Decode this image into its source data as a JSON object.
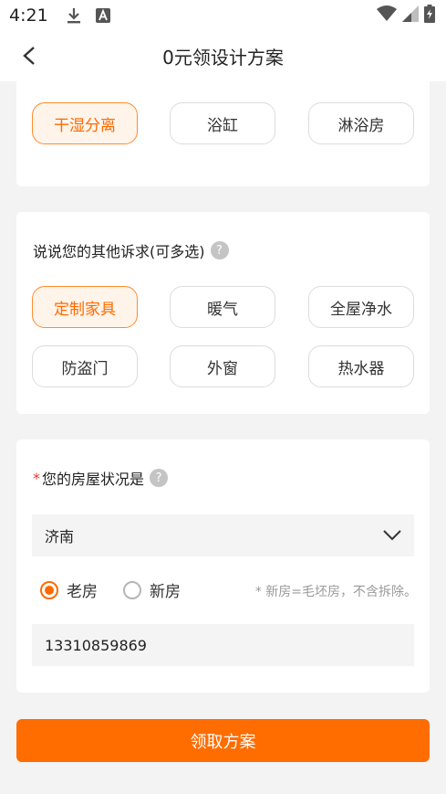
{
  "status_bar": {
    "time": "4:21",
    "icons": [
      "download-icon",
      "font-a-icon",
      "wifi-icon",
      "cell-signal-icon",
      "battery-charging-icon"
    ]
  },
  "header": {
    "title": "0元领设计方案",
    "back_icon": "chevron-left-icon"
  },
  "bathroom_options": [
    {
      "label": "干湿分离",
      "selected": true
    },
    {
      "label": "浴缸",
      "selected": false
    },
    {
      "label": "淋浴房",
      "selected": false
    }
  ],
  "other_requests": {
    "question": "说说您的其他诉求(可多选)",
    "help_mark": "?",
    "options": [
      {
        "label": "定制家具",
        "selected": true
      },
      {
        "label": "暖气",
        "selected": false
      },
      {
        "label": "全屋净水",
        "selected": false
      },
      {
        "label": "防盗门",
        "selected": false
      },
      {
        "label": "外窗",
        "selected": false
      },
      {
        "label": "热水器",
        "selected": false
      }
    ]
  },
  "house_status": {
    "required_mark": "*",
    "question": "您的房屋状况是",
    "help_mark": "?",
    "city": "济南",
    "radio_old": "老房",
    "radio_new": "新房",
    "selected": "老房",
    "note": "* 新房=毛坯房，不含拆除。",
    "phone": "13310859869"
  },
  "submit_label": "领取方案",
  "colors": {
    "accent": "#ff6c00",
    "selected_bg": "#fff4ea",
    "page_bg": "#f3f3f3"
  }
}
